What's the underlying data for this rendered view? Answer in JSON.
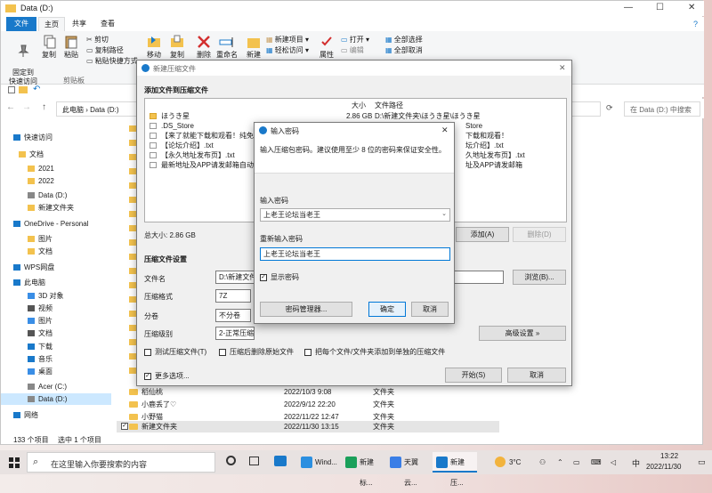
{
  "window": {
    "title": "Data (D:)",
    "minimize": "—",
    "maximize": "☐",
    "close": "✕",
    "help": "?"
  },
  "ribbon_tabs": [
    "文件",
    "主页",
    "共享",
    "查看"
  ],
  "ribbon": {
    "pin_label": "固定到\n快速访问",
    "copy_label": "复制",
    "paste_label": "粘贴",
    "cut_label": "剪切",
    "copy_path_label": "复制路径",
    "paste_shortcut_label": "粘贴快捷方式",
    "move_to_label": "移动到",
    "copy_to_label": "复制到",
    "delete_label": "删除",
    "rename_label": "重命名",
    "new_folder_label": "新建",
    "new_item_label": "新建项目",
    "easy_access_label": "轻松访问",
    "properties_label": "属性",
    "open_label": "打开",
    "edit_label": "编辑",
    "select_all_label": "全部选择",
    "select_none_label": "全部取消",
    "clipboard_group": "剪贴板"
  },
  "address": {
    "path": "此电脑 › Data (D:)",
    "search_placeholder": "在 Data (D:) 中搜索"
  },
  "nav": [
    {
      "label": "快速访问",
      "color": "#1979ca"
    },
    {
      "label": "文档",
      "color": "#f3c24e"
    },
    {
      "label": "2021",
      "color": "#f3c24e"
    },
    {
      "label": "2022",
      "color": "#f3c24e"
    },
    {
      "label": "Data (D:)",
      "color": "#888888"
    },
    {
      "label": "新建文件夹",
      "color": "#f3c24e"
    },
    {
      "label": "OneDrive - Personal",
      "color": "#1979ca"
    },
    {
      "label": "图片",
      "color": "#f3c24e"
    },
    {
      "label": "文档",
      "color": "#f3c24e"
    },
    {
      "label": "WPS网盘",
      "color": "#1979ca"
    },
    {
      "label": "此电脑",
      "color": "#1979ca"
    },
    {
      "label": "3D 对象",
      "color": "#3a8ee6"
    },
    {
      "label": "视频",
      "color": "#555555"
    },
    {
      "label": "图片",
      "color": "#3a8ee6"
    },
    {
      "label": "文档",
      "color": "#555555"
    },
    {
      "label": "下载",
      "color": "#1979ca"
    },
    {
      "label": "音乐",
      "color": "#1979ca"
    },
    {
      "label": "桌面",
      "color": "#3a8ee6"
    },
    {
      "label": "Acer (C:)",
      "color": "#888888"
    },
    {
      "label": "Data (D:)",
      "color": "#888888"
    },
    {
      "label": "网络",
      "color": "#1979ca"
    }
  ],
  "files": [
    {
      "name": "稻仙桃",
      "date": "2022/10/3 9:08",
      "type": "文件夹"
    },
    {
      "name": "小鹿丢了♡",
      "date": "2022/9/12 22:20",
      "type": "文件夹"
    },
    {
      "name": "小野猫",
      "date": "2022/11/22 12:47",
      "type": "文件夹"
    },
    {
      "name": "新建文件夹",
      "date": "2022/11/30 13:15",
      "type": "文件夹"
    }
  ],
  "status": {
    "count": "133 个项目",
    "selected": "选中 1 个项目"
  },
  "compress": {
    "title": "新建压缩文件",
    "add_section": "添加文件到压缩文件",
    "col_size": "大小",
    "col_path": "文件路径",
    "items": [
      {
        "name": "ほうき星",
        "size": "2.86 GB",
        "path": "D:\\新建文件夹\\ほうき星\\ほうき星"
      },
      {
        "name": ".DS_Store",
        "size": "",
        "path": "Store"
      },
      {
        "name": "【来了就能下载和观看！纯免费",
        "size": "",
        "path": "下载和观看！"
      },
      {
        "name": "【论坛介绍】.txt",
        "size": "",
        "path": "坛介绍】.txt"
      },
      {
        "name": "【永久地址发布页】.txt",
        "size": "",
        "path": "久地址发布页】.txt"
      },
      {
        "name": "最新地址及APP请发邮箱自动获取",
        "size": "",
        "path": "址及APP请发邮箱"
      }
    ],
    "total_size": "总大小: 2.86 GB",
    "add_button": "添加(A)",
    "remove_button": "删除(D)",
    "settings_section": "压缩文件设置",
    "filename_label": "文件名",
    "filename_value": "D:\\新建文件",
    "browse_button": "浏览(B)...",
    "format_label": "压缩格式",
    "format_value": "7Z",
    "split_label": "分卷",
    "split_value": "不分卷",
    "level_label": "压缩级别",
    "level_value": "2-正常压缩",
    "advanced_button": "高级设置 »",
    "test_label": "测试压缩文件(T)",
    "delete_after_label": "压缩后删除原始文件",
    "each_file_label": "把每个文件/文件夹添加到单独的压缩文件",
    "more_options_label": "更多选项...",
    "start_button": "开始(S)",
    "cancel_button": "取消"
  },
  "password": {
    "title": "输入密码",
    "info": "输入压缩包密码。建议使用至少 8 位的密码来保证安全性。",
    "enter_label": "输入密码",
    "enter_value": "上老王论坛当老王",
    "reenter_label": "重新输入密码",
    "reenter_value": "上老王论坛当老王",
    "show_label": "显示密码",
    "manager_button": "密码管理器...",
    "ok_button": "确定",
    "cancel_button": "取消"
  },
  "taskbar": {
    "search_placeholder": "在这里输入你要搜索的内容",
    "items": [
      {
        "label": "Wind...",
        "color": "#2b8fe0"
      },
      {
        "label": "新建标...",
        "color": "#1aa05a"
      },
      {
        "label": "天翼云...",
        "color": "#3a7ee6"
      },
      {
        "label": "新建压...",
        "color": "#1979ca"
      }
    ],
    "temp": "3°C",
    "ime": "中",
    "time": "13:22",
    "date": "2022/11/30"
  },
  "colors": {
    "accent": "#1979ca",
    "folder": "#f3c24e"
  }
}
